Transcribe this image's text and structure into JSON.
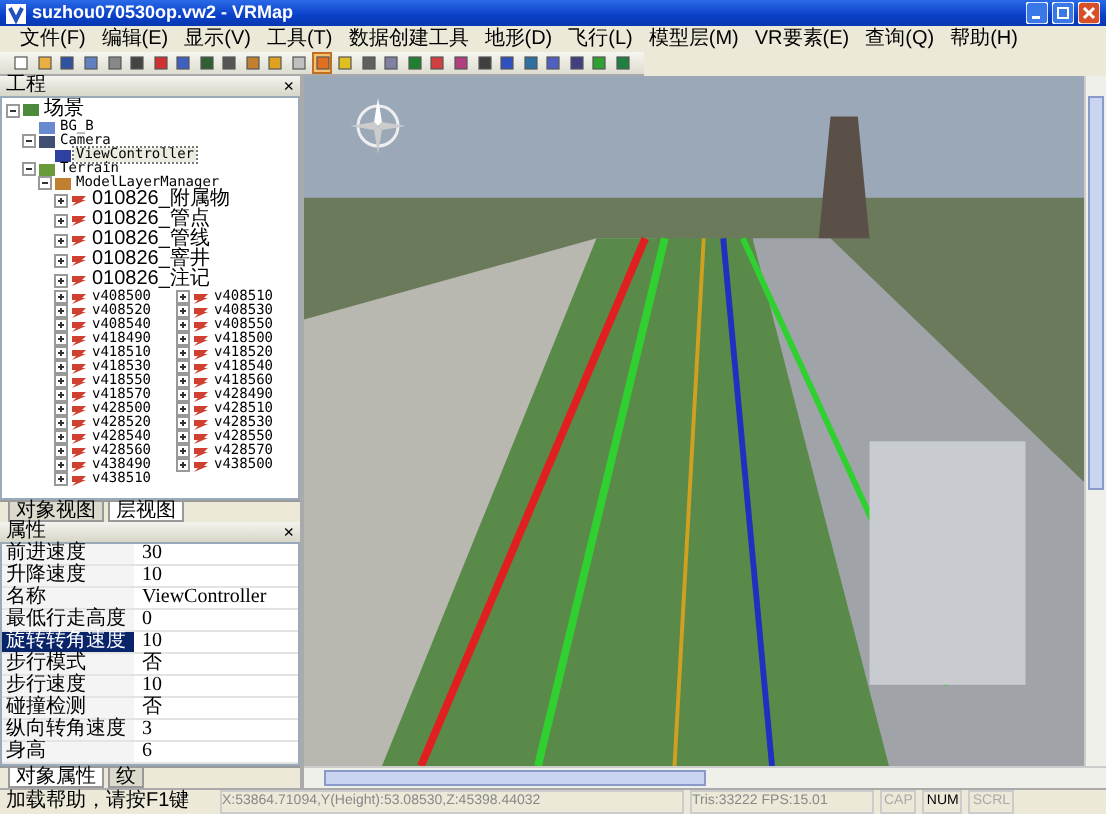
{
  "window": {
    "title": "suzhou070530op.vw2 - VRMap"
  },
  "menu": [
    "文件(F)",
    "编辑(E)",
    "显示(V)",
    "工具(T)",
    "数据创建工具",
    "地形(D)",
    "飞行(L)",
    "模型层(M)",
    "VR要素(E)",
    "查询(Q)",
    "帮助(H)"
  ],
  "toolbar": [
    {
      "selected": false
    },
    {
      "selected": false
    },
    {
      "selected": false
    },
    {
      "selected": false
    },
    {
      "selected": false
    },
    {
      "selected": false
    },
    {
      "selected": false
    },
    {
      "selected": false
    },
    {
      "selected": false
    },
    {
      "selected": false
    },
    {
      "selected": false
    },
    {
      "selected": false
    },
    {
      "selected": false
    },
    {
      "selected": true
    },
    {
      "selected": false
    },
    {
      "selected": false
    },
    {
      "selected": false
    },
    {
      "selected": false
    },
    {
      "selected": false
    },
    {
      "selected": false
    },
    {
      "selected": false
    },
    {
      "selected": false
    },
    {
      "selected": false
    },
    {
      "selected": false
    },
    {
      "selected": false
    },
    {
      "selected": false
    },
    {
      "selected": false
    }
  ],
  "tree_panel": {
    "title": "工程",
    "close": "×"
  },
  "tree": [
    {
      "label": "场景",
      "kind": "scene",
      "expanded": true,
      "selected": false,
      "children": [
        {
          "label": "BG_B",
          "kind": "background",
          "selected": false
        },
        {
          "label": "Camera",
          "kind": "camera",
          "expanded": true,
          "selected": false,
          "children": [
            {
              "label": "ViewController",
              "kind": "controller",
              "selected": true
            }
          ]
        },
        {
          "label": "Terrain",
          "kind": "terrain",
          "expanded": true,
          "selected": false,
          "children": [
            {
              "label": "ModelLayerManager",
              "kind": "manager",
              "expanded": true,
              "selected": false,
              "children": [
                {
                  "label": "010826_附属物",
                  "kind": "named-layer",
                  "expanded": false,
                  "selected": false
                },
                {
                  "label": "010826_管点",
                  "kind": "named-layer",
                  "expanded": false,
                  "selected": false
                },
                {
                  "label": "010826_管线",
                  "kind": "named-layer",
                  "expanded": false,
                  "selected": false
                },
                {
                  "label": "010826_窨井",
                  "kind": "named-layer",
                  "expanded": false,
                  "selected": false
                },
                {
                  "label": "010826_注记",
                  "kind": "named-layer",
                  "expanded": false,
                  "selected": false
                },
                {
                  "label": "v408500",
                  "kind": "tile-layer",
                  "expanded": false,
                  "selected": false
                },
                {
                  "label": "v408510",
                  "kind": "tile-layer",
                  "expanded": false,
                  "selected": false
                },
                {
                  "label": "v408520",
                  "kind": "tile-layer",
                  "expanded": false,
                  "selected": false
                },
                {
                  "label": "v408530",
                  "kind": "tile-layer",
                  "expanded": false,
                  "selected": false
                },
                {
                  "label": "v408540",
                  "kind": "tile-layer",
                  "expanded": false,
                  "selected": false
                },
                {
                  "label": "v408550",
                  "kind": "tile-layer",
                  "expanded": false,
                  "selected": false
                },
                {
                  "label": "v418490",
                  "kind": "tile-layer",
                  "expanded": false,
                  "selected": false
                },
                {
                  "label": "v418500",
                  "kind": "tile-layer",
                  "expanded": false,
                  "selected": false
                },
                {
                  "label": "v418510",
                  "kind": "tile-layer",
                  "expanded": false,
                  "selected": false
                },
                {
                  "label": "v418520",
                  "kind": "tile-layer",
                  "expanded": false,
                  "selected": false
                },
                {
                  "label": "v418530",
                  "kind": "tile-layer",
                  "expanded": false,
                  "selected": false
                },
                {
                  "label": "v418540",
                  "kind": "tile-layer",
                  "expanded": false,
                  "selected": false
                },
                {
                  "label": "v418550",
                  "kind": "tile-layer",
                  "expanded": false,
                  "selected": false
                },
                {
                  "label": "v418560",
                  "kind": "tile-layer",
                  "expanded": false,
                  "selected": false
                },
                {
                  "label": "v418570",
                  "kind": "tile-layer",
                  "expanded": false,
                  "selected": false
                },
                {
                  "label": "v428490",
                  "kind": "tile-layer",
                  "expanded": false,
                  "selected": false
                },
                {
                  "label": "v428500",
                  "kind": "tile-layer",
                  "expanded": false,
                  "selected": false
                },
                {
                  "label": "v428510",
                  "kind": "tile-layer",
                  "expanded": false,
                  "selected": false
                },
                {
                  "label": "v428520",
                  "kind": "tile-layer",
                  "expanded": false,
                  "selected": false
                },
                {
                  "label": "v428530",
                  "kind": "tile-layer",
                  "expanded": false,
                  "selected": false
                },
                {
                  "label": "v428540",
                  "kind": "tile-layer",
                  "expanded": false,
                  "selected": false
                },
                {
                  "label": "v428550",
                  "kind": "tile-layer",
                  "expanded": false,
                  "selected": false
                },
                {
                  "label": "v428560",
                  "kind": "tile-layer",
                  "expanded": false,
                  "selected": false
                },
                {
                  "label": "v428570",
                  "kind": "tile-layer",
                  "expanded": false,
                  "selected": false
                },
                {
                  "label": "v438490",
                  "kind": "tile-layer",
                  "expanded": false,
                  "selected": false
                },
                {
                  "label": "v438500",
                  "kind": "tile-layer",
                  "expanded": false,
                  "selected": false
                },
                {
                  "label": "v438510",
                  "kind": "tile-layer",
                  "expanded": false,
                  "selected": false
                }
              ]
            }
          ]
        }
      ]
    }
  ],
  "view_tabs": [
    {
      "label": "对象视图",
      "selected": false
    },
    {
      "label": "层视图",
      "selected": true
    }
  ],
  "properties_panel": {
    "title": "属性",
    "close": "×"
  },
  "properties": [
    {
      "name": "前进速度",
      "value": "30",
      "selected": false
    },
    {
      "name": "升降速度",
      "value": "10",
      "selected": false
    },
    {
      "name": "名称",
      "value": "ViewController",
      "selected": false
    },
    {
      "name": "最低行走高度",
      "value": "0",
      "selected": false
    },
    {
      "name": "旋转转角速度",
      "value": "10",
      "selected": true
    },
    {
      "name": "步行模式",
      "value": "否",
      "selected": false
    },
    {
      "name": "步行速度",
      "value": "10",
      "selected": false
    },
    {
      "name": "碰撞检测",
      "value": "否",
      "selected": false
    },
    {
      "name": "纵向转角速度",
      "value": "3",
      "selected": false
    },
    {
      "name": "身高",
      "value": "6",
      "selected": false
    }
  ],
  "property_tabs": [
    {
      "label": "对象属性",
      "selected": true
    },
    {
      "label": "纹",
      "selected": false
    }
  ],
  "status_bar": {
    "help": "加载帮助，请按F1键",
    "coordinates": "X:53864.71094,Y(Height):53.08530,Z:45398.44032",
    "stats": "Tris:33222 FPS:15.01",
    "indicators": [
      {
        "label": "CAP",
        "on": false
      },
      {
        "label": "NUM",
        "on": true
      },
      {
        "label": "SCRL",
        "on": false
      }
    ]
  }
}
